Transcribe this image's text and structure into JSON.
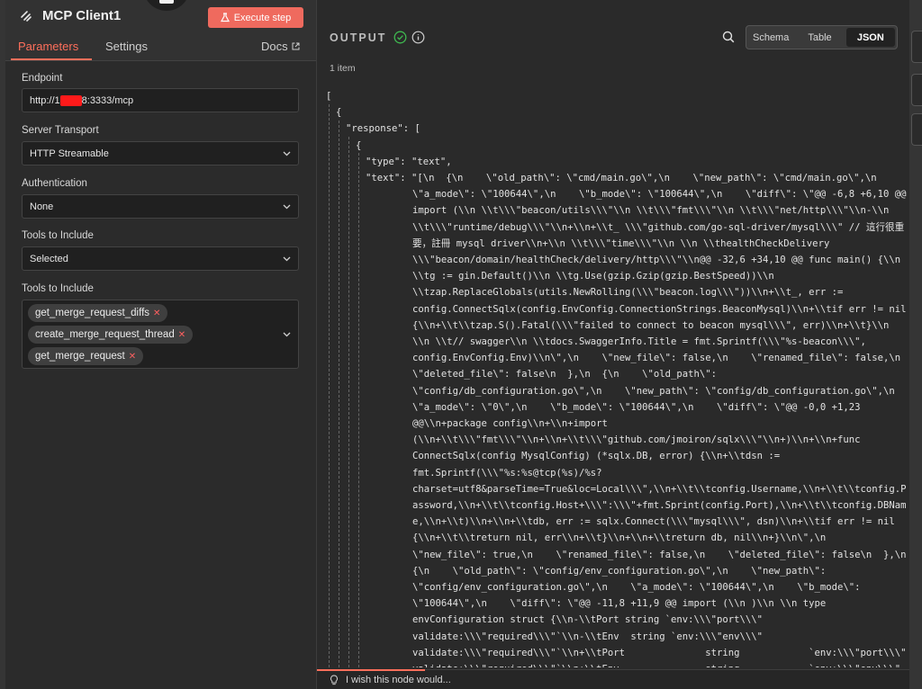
{
  "node": {
    "title": "MCP Client1",
    "execute_label": "Execute step"
  },
  "tabs": {
    "parameters": "Parameters",
    "settings": "Settings",
    "docs": "Docs"
  },
  "fields": {
    "endpoint": {
      "label": "Endpoint",
      "value_prefix": "http://1",
      "value_suffix": "8:3333/mcp"
    },
    "transport": {
      "label": "Server Transport",
      "value": "HTTP Streamable"
    },
    "auth": {
      "label": "Authentication",
      "value": "None"
    },
    "tools_mode": {
      "label": "Tools to Include",
      "value": "Selected"
    },
    "tools_list": {
      "label": "Tools to Include",
      "chips": [
        "get_merge_request_diffs",
        "create_merge_request_thread",
        "get_merge_request"
      ]
    }
  },
  "output": {
    "title": "OUTPUT",
    "item_count": "1 item",
    "views": [
      "Schema",
      "Table",
      "JSON"
    ],
    "active_view": "JSON",
    "json_lines": [
      "[",
      "{",
      "\"response\": [",
      "{",
      "\"type\": \"text\",",
      "\"text\": \"[\\n  {\\n    \\\"old_path\\\": \\\"cmd/main.go\\\",\\n    \\\"new_path\\\": \\\"cmd/main.go\\\",\\n",
      "\\\"a_mode\\\": \\\"100644\\\",\\n    \\\"b_mode\\\": \\\"100644\\\",\\n    \\\"diff\\\": \\\"@@ -6,8 +6,10 @@",
      "import (\\\\n \\\\t\\\\\\\"beacon/utils\\\\\\\"\\\\n \\\\t\\\\\\\"fmt\\\\\\\"\\\\n \\\\t\\\\\\\"net/http\\\\\\\"\\\\n-\\\\n",
      "\\\\t\\\\\\\"runtime/debug\\\\\\\"\\\\n+\\\\n+\\\\t_ \\\\\\\"github.com/go-sql-driver/mysql\\\\\\\" // 這行很重",
      "要，註冊 mysql driver\\\\n+\\\\n \\\\t\\\\\\\"time\\\\\\\"\\\\n \\\\n \\\\thealthCheckDelivery",
      "\\\\\\\"beacon/domain/healthCheck/delivery/http\\\\\\\"\\\\n@@ -32,6 +34,10 @@ func main() {\\\\n",
      "\\\\tg := gin.Default()\\\\n \\\\tg.Use(gzip.Gzip(gzip.BestSpeed))\\\\n",
      "\\\\tzap.ReplaceGlobals(utils.NewRolling(\\\\\\\"beacon.log\\\\\\\"))\\\\n+\\\\t_, err :=",
      "config.ConnectSqlx(config.EnvConfig.ConnectionStrings.BeaconMysql)\\\\n+\\\\tif err != nil",
      "{\\\\n+\\\\t\\\\tzap.S().Fatal(\\\\\\\"failed to connect to beacon mysql\\\\\\\", err)\\\\n+\\\\t}\\\\n",
      "\\\\n \\\\t// swagger\\\\n \\\\tdocs.SwaggerInfo.Title = fmt.Sprintf(\\\\\\\"%s-beacon\\\\\\\",",
      "config.EnvConfig.Env)\\\\n\\\",\\n    \\\"new_file\\\": false,\\n    \\\"renamed_file\\\": false,\\n",
      "\\\"deleted_file\\\": false\\n  },\\n  {\\n    \\\"old_path\\\":",
      "\\\"config/db_configuration.go\\\",\\n    \\\"new_path\\\": \\\"config/db_configuration.go\\\",\\n",
      "\\\"a_mode\\\": \\\"0\\\",\\n    \\\"b_mode\\\": \\\"100644\\\",\\n    \\\"diff\\\": \\\"@@ -0,0 +1,23",
      "@@\\\\n+package config\\\\n+\\\\n+import",
      "(\\\\n+\\\\t\\\\\\\"fmt\\\\\\\"\\\\n+\\\\n+\\\\t\\\\\\\"github.com/jmoiron/sqlx\\\\\\\"\\\\n+)\\\\n+\\\\n+func",
      "ConnectSqlx(config MysqlConfig) (*sqlx.DB, error) {\\\\n+\\\\tdsn :=",
      "fmt.Sprintf(\\\\\\\"%s:%s@tcp(%s)/%s?",
      "charset=utf8&parseTime=True&loc=Local\\\\\\\",\\\\n+\\\\t\\\\tconfig.Username,\\\\n+\\\\t\\\\tconfig.P",
      "assword,\\\\n+\\\\t\\\\tconfig.Host+\\\\\\\":\\\\\\\"+fmt.Sprint(config.Port),\\\\n+\\\\t\\\\tconfig.DBNam",
      "e,\\\\n+\\\\t)\\\\n+\\\\n+\\\\tdb, err := sqlx.Connect(\\\\\\\"mysql\\\\\\\", dsn)\\\\n+\\\\tif err != nil",
      "{\\\\n+\\\\t\\\\treturn nil, err\\\\n+\\\\t}\\\\n+\\\\n+\\\\treturn db, nil\\\\n+}\\\\n\\\",\\n",
      "\\\"new_file\\\": true,\\n    \\\"renamed_file\\\": false,\\n    \\\"deleted_file\\\": false\\n  },\\n",
      "{\\n    \\\"old_path\\\": \\\"config/env_configuration.go\\\",\\n    \\\"new_path\\\":",
      "\\\"config/env_configuration.go\\\",\\n    \\\"a_mode\\\": \\\"100644\\\",\\n    \\\"b_mode\\\":",
      "\\\"100644\\\",\\n    \\\"diff\\\": \\\"@@ -11,8 +11,9 @@ import (\\\\n )\\\\n \\\\n type",
      "envConfiguration struct {\\\\n-\\\\tPort string `env:\\\\\\\"port\\\\\\\"",
      "validate:\\\\\\\"required\\\\\\\"`\\\\n-\\\\tEnv  string `env:\\\\\\\"env\\\\\\\"",
      "validate:\\\\\\\"required\\\\\\\"`\\\\n+\\\\tPort              string            `env:\\\\\\\"port\\\\\\\"",
      "validate:\\\\\\\"required\\\\\\\"`\\\\n+\\\\tEnv               string            `env:\\\\\\\"env\\\\\\\""
    ]
  },
  "footer": {
    "feedback": "I wish this node would..."
  },
  "colors": {
    "accent": "#ff6f5b",
    "execute": "#ef6a5e",
    "redaction": "#ff1a1a",
    "success": "#3fb950"
  }
}
